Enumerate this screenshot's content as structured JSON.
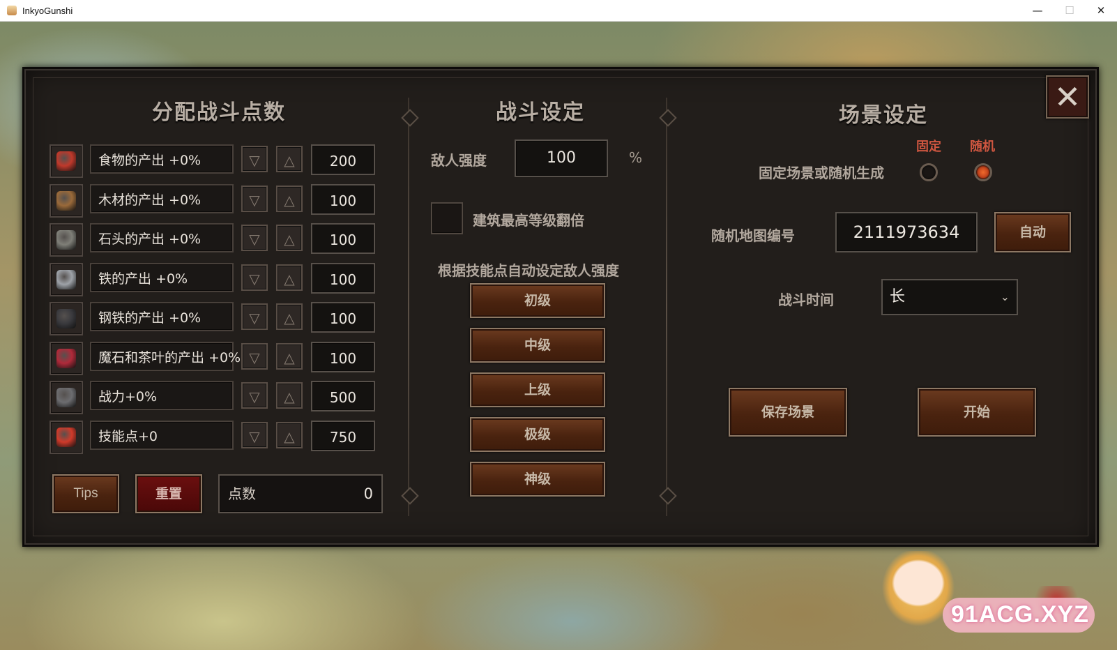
{
  "window": {
    "title": "InkyoGunshi",
    "min": "—",
    "max": "☐",
    "close": "✕"
  },
  "dialog": {
    "close_glyph": "✕"
  },
  "left": {
    "heading": "分配战斗点数",
    "rows": [
      {
        "label": "食物的产出 +0%",
        "value": "200",
        "icon": "meat-icon",
        "color": "#c0392b"
      },
      {
        "label": "木材的产出 +0%",
        "value": "100",
        "icon": "wood-logs-icon",
        "color": "#9a6a3a"
      },
      {
        "label": "石头的产出 +0%",
        "value": "100",
        "icon": "stone-icon",
        "color": "#7f7f78"
      },
      {
        "label": "铁的产出 +0%",
        "value": "100",
        "icon": "iron-ingot-icon",
        "color": "#9ea2a8"
      },
      {
        "label": "钢铁的产出 +0%",
        "value": "100",
        "icon": "steel-bar-icon",
        "color": "#3a3a3e"
      },
      {
        "label": "魔石和茶叶的产出 +0%",
        "value": "100",
        "icon": "magic-stone-tea-icon",
        "color": "#b02a3a"
      },
      {
        "label": "战力+0%",
        "value": "500",
        "icon": "helmet-icon",
        "color": "#6d6d70"
      },
      {
        "label": "技能点+0",
        "value": "750",
        "icon": "skill-points-icon",
        "color": "#d03a2a"
      }
    ],
    "arrow_down": "▽",
    "arrow_up": "△",
    "tips_label": "Tips",
    "reset_label": "重置",
    "points_label": "点数",
    "points_value": "0"
  },
  "middle": {
    "heading": "战斗设定",
    "enemy_strength_label": "敌人强度",
    "enemy_strength_value": "100",
    "percent": "%",
    "double_building_label": "建筑最高等级翻倍",
    "auto_set_label": "根据技能点自动设定敌人强度",
    "difficulty_buttons": [
      "初级",
      "中级",
      "上级",
      "极级",
      "神级"
    ]
  },
  "right": {
    "heading": "场景设定",
    "fixed_label": "固定",
    "random_label": "随机",
    "scene_mode_label": "固定场景或随机生成",
    "selected_mode": "random",
    "map_id_label": "随机地图编号",
    "map_id_value": "2111973634",
    "auto_label": "自动",
    "battle_time_label": "战斗时间",
    "battle_time_value": "长",
    "save_scene_label": "保存场景",
    "start_label": "开始"
  },
  "watermark": "91ACG.XYZ",
  "colors": {
    "accent": "#cf5640",
    "panel": "#221e1b",
    "wood": "#4a230f"
  }
}
